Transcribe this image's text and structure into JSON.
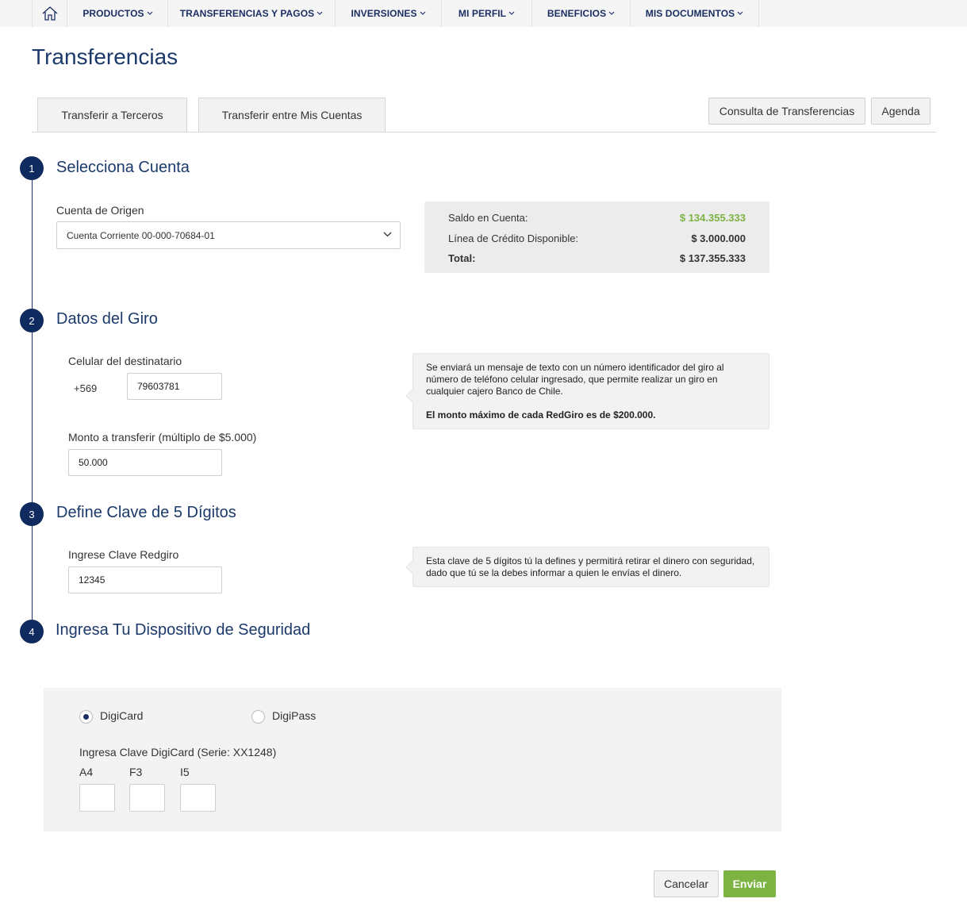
{
  "colors": {
    "brand_navy": "#1b2f63",
    "title_blue": "#1b3a6b",
    "positive_green": "#7cb342",
    "nav_bg": "#f5f5f6"
  },
  "nav": {
    "home_icon": "home-icon",
    "items": [
      {
        "label": "PRODUCTOS"
      },
      {
        "label": "TRANSFERENCIAS Y PAGOS"
      },
      {
        "label": "INVERSIONES"
      },
      {
        "label": "MI PERFIL"
      },
      {
        "label": "BENEFICIOS"
      },
      {
        "label": "MIS DOCUMENTOS"
      }
    ]
  },
  "page": {
    "title": "Transferencias"
  },
  "tabs": [
    {
      "label": "Transferir a Terceros"
    },
    {
      "label": "Transferir entre Mis Cuentas"
    }
  ],
  "actions": {
    "consulta": "Consulta de Transferencias",
    "agenda": "Agenda"
  },
  "steps": [
    {
      "number": "1",
      "title": "Selecciona Cuenta"
    },
    {
      "number": "2",
      "title": "Datos del Giro"
    },
    {
      "number": "3",
      "title": "Define Clave de 5 Dígitos"
    },
    {
      "number": "4",
      "title": "Ingresa Tu Dispositivo de Seguridad"
    }
  ],
  "cuenta": {
    "label": "Cuenta de Origen",
    "selected": "Cuenta Corriente 00-000-70684-01"
  },
  "saldo": {
    "saldo_label": "Saldo en Cuenta:",
    "saldo_value": "$ 134.355.333",
    "credito_label": "Línea de Crédito Disponible:",
    "credito_value": "$ 3.000.000",
    "total_label": "Total:",
    "total_value": "$ 137.355.333"
  },
  "giro": {
    "celular_label": "Celular del destinatario",
    "prefix": "+569",
    "celular_value": "79603781",
    "monto_label": "Monto a transferir (múltiplo de $5.000)",
    "monto_value": "50.000",
    "info_line1": "Se enviará un mensaje de texto con un número identificador del giro al",
    "info_line2": "número de teléfono celular ingresado, que permite realizar un giro en",
    "info_line3": "cualquier cajero Banco de Chile.",
    "info_bold": "El monto máximo de cada RedGiro es de $200.000."
  },
  "clave": {
    "label": "Ingrese Clave Redgiro",
    "value": "12345",
    "info_line1": "Esta clave de 5 dígitos tú la defines y permitirá retirar el dinero con seguridad,",
    "info_line2": "dado que tú se la debes informar a quien le envías el dinero."
  },
  "seguridad": {
    "option_digicard": "DigiCard",
    "option_digipass": "DigiPass",
    "selected": "DigiCard",
    "prompt": "Ingresa Clave DigiCard (Serie: XX1248)",
    "coords": [
      {
        "label": "A4",
        "value": ""
      },
      {
        "label": "F3",
        "value": ""
      },
      {
        "label": "I5",
        "value": ""
      }
    ]
  },
  "buttons": {
    "cancel": "Cancelar",
    "send": "Enviar"
  }
}
